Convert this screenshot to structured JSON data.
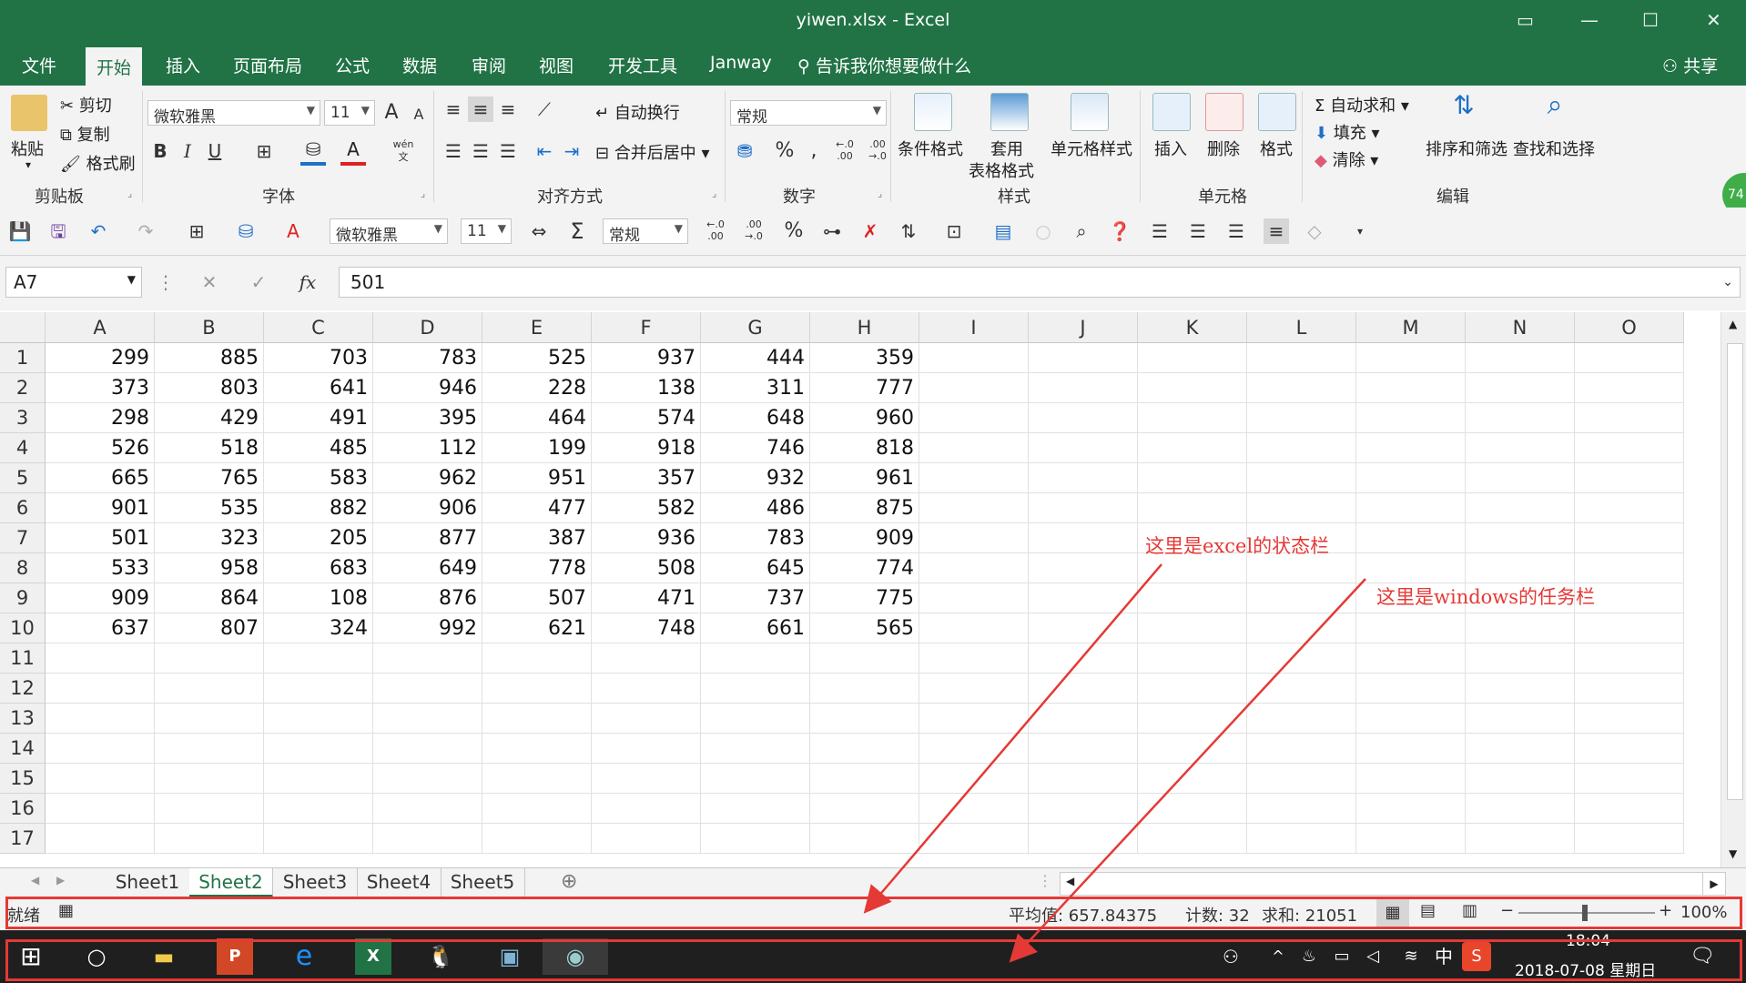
{
  "window": {
    "title": "yiwen.xlsx  -  Excel"
  },
  "ribbon_tabs": [
    "文件",
    "开始",
    "插入",
    "页面布局",
    "公式",
    "数据",
    "审阅",
    "视图",
    "开发工具",
    "Janway"
  ],
  "tellme": "告诉我你想要做什么",
  "share": "共享",
  "clipboard": {
    "paste": "粘贴",
    "cut": "剪切",
    "copy": "复制",
    "painter": "格式刷",
    "label": "剪贴板"
  },
  "font": {
    "name": "微软雅黑",
    "size": "11",
    "label": "字体",
    "bold": "B",
    "italic": "I",
    "underline": "U",
    "fontcolor": "A",
    "grow": "A",
    "shrink": "A",
    "wen": "wén文"
  },
  "alignment": {
    "wrap": "自动换行",
    "merge": "合并后居中",
    "label": "对齐方式"
  },
  "number": {
    "format": "常规",
    "percent": "%",
    "comma": ",",
    "label": "数字"
  },
  "styles": {
    "conditional": "条件格式",
    "table1": "套用",
    "table2": "表格格式",
    "cellstyle": "单元格样式",
    "label": "样式"
  },
  "cells": {
    "insert": "插入",
    "delete": "删除",
    "format": "格式",
    "label": "单元格"
  },
  "editing": {
    "autosum": "自动求和",
    "fill": "填充",
    "clear": "清除",
    "sort": "排序和筛选",
    "find": "查找和选择",
    "label": "编辑"
  },
  "qat": {
    "font": "微软雅黑",
    "size": "11",
    "format": "常规"
  },
  "formula": {
    "namebox": "A7",
    "value": "501",
    "fx": "fx"
  },
  "grid": {
    "columns": [
      "A",
      "B",
      "C",
      "D",
      "E",
      "F",
      "G",
      "H",
      "I",
      "J",
      "K",
      "L",
      "M",
      "N",
      "O"
    ],
    "rows": [
      "1",
      "2",
      "3",
      "4",
      "5",
      "6",
      "7",
      "8",
      "9",
      "10",
      "11",
      "12",
      "13",
      "14",
      "15",
      "16",
      "17"
    ],
    "values": [
      [
        "299",
        "885",
        "703",
        "783",
        "525",
        "937",
        "444",
        "359"
      ],
      [
        "373",
        "803",
        "641",
        "946",
        "228",
        "138",
        "311",
        "777"
      ],
      [
        "298",
        "429",
        "491",
        "395",
        "464",
        "574",
        "648",
        "960"
      ],
      [
        "526",
        "518",
        "485",
        "112",
        "199",
        "918",
        "746",
        "818"
      ],
      [
        "665",
        "765",
        "583",
        "962",
        "951",
        "357",
        "932",
        "961"
      ],
      [
        "901",
        "535",
        "882",
        "906",
        "477",
        "582",
        "486",
        "875"
      ],
      [
        "501",
        "323",
        "205",
        "877",
        "387",
        "936",
        "783",
        "909"
      ],
      [
        "533",
        "958",
        "683",
        "649",
        "778",
        "508",
        "645",
        "774"
      ],
      [
        "909",
        "864",
        "108",
        "876",
        "507",
        "471",
        "737",
        "775"
      ],
      [
        "637",
        "807",
        "324",
        "992",
        "621",
        "748",
        "661",
        "565"
      ]
    ]
  },
  "sheets": [
    "Sheet1",
    "Sheet2",
    "Sheet3",
    "Sheet4",
    "Sheet5"
  ],
  "active_sheet": 1,
  "status": {
    "ready": "就绪",
    "average": "平均值: 657.84375",
    "count": "计数: 32",
    "sum": "求和: 21051",
    "zoom": "100%"
  },
  "taskbar": {
    "time": "18:04",
    "date": "2018-07-08 星期日",
    "ime": "中"
  },
  "annotations": {
    "excel_status": "这里是excel的状态栏",
    "windows_taskbar": "这里是windows的任务栏"
  },
  "badge": "74",
  "colors": {
    "excel_green": "#217346",
    "annotation_red": "#e53935"
  }
}
